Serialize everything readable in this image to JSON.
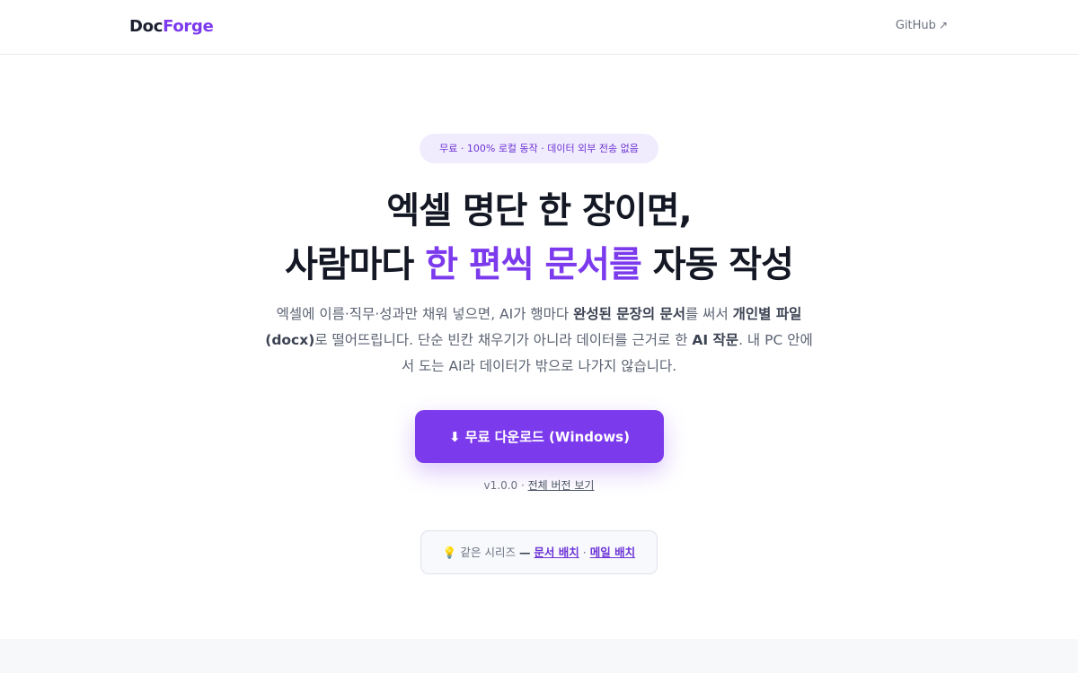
{
  "header": {
    "logo_part1": "Doc",
    "logo_part2": "Forge",
    "github_label": "GitHub",
    "github_arrow": "↗"
  },
  "hero": {
    "badge": "무료 · 100% 로컬 동작 · 데이터 외부 전송 없음",
    "title_line1": "엑셀 명단 한 장이면,",
    "title_line2_pre": "사람마다 ",
    "title_line2_highlight": "한 편씩 문서를",
    "title_line2_post": " 자동 작성",
    "desc": {
      "t1": "엑셀에 이름·직무·성과만 채워 넣으면, AI가 행마다 ",
      "b1": "완성된 문장의 문서",
      "t2": "를 써서 ",
      "b2": "개인별 파일(docx)",
      "t3": "로 떨어뜨립니다. 단순 빈칸 채우기가 아니라 데이터를 근거로 한 ",
      "b3": "AI 작문",
      "t4": ". 내 PC 안에서 도는 AI라 데이터가 밖으로 나가지 않습니다."
    },
    "cta_icon": "download-icon",
    "cta_label": "⬇ 무료 다운로드 (Windows)",
    "version_text": "v1.0.0 · ",
    "versions_link": "전체 버전 보기"
  },
  "series": {
    "icon": "lightbulb-icon",
    "label": "같은 시리즈 ",
    "dash": "—",
    "link1": "문서 배치",
    "sep": "·",
    "link2": "메일 배치"
  },
  "colors": {
    "accent": "#7c3aed",
    "badge_bg": "#f1ecfd",
    "text_dark": "#141824",
    "text_muted": "#5b6272"
  }
}
